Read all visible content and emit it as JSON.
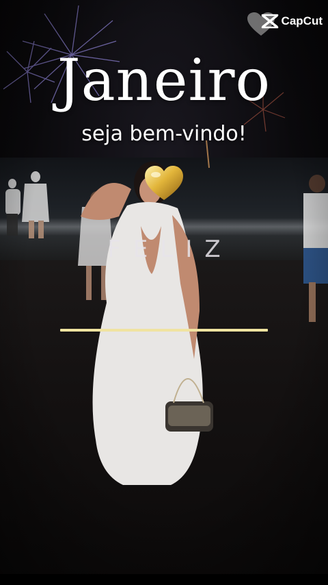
{
  "watermark": {
    "brand": "CapCut",
    "logo_icon": "capcut-logo-icon",
    "badge_icon": "heart-icon"
  },
  "overlay": {
    "title": "Janeiro",
    "subtitle": "seja bem-vindo!",
    "word": "FELIZ",
    "heart_icon": "gold-heart-icon",
    "accent_color": "#f0e3a0"
  }
}
